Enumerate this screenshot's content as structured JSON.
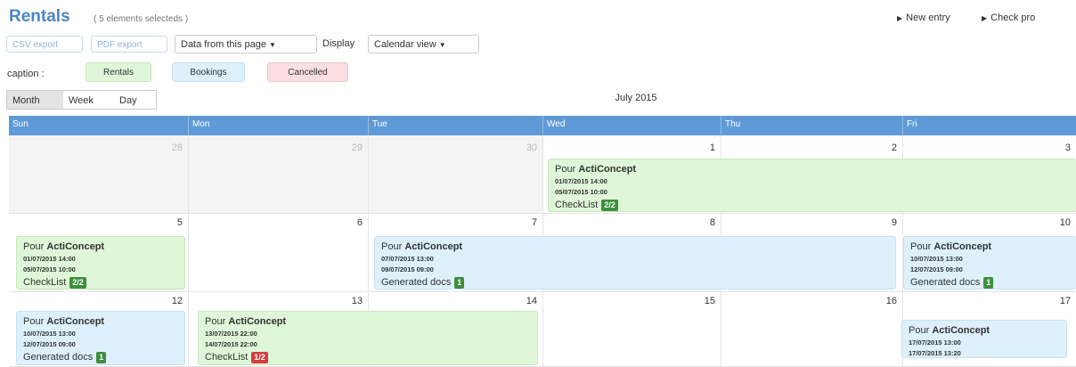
{
  "header": {
    "title": "Rentals",
    "subtitle": "( 5 elements selecteds )",
    "new_entry": "New entry",
    "check": "Check pro"
  },
  "toolbar": {
    "csv_export": "CSV export",
    "pdf_export": "PDF export",
    "data_from": "Data from this page",
    "display_label": "Display",
    "view_select": "Calendar view"
  },
  "legend": {
    "label": "caption :",
    "rentals": "Rentals",
    "bookings": "Bookings",
    "cancelled": "Cancelled"
  },
  "views": {
    "month": "Month",
    "week": "Week",
    "day": "Day"
  },
  "month_label": "July 2015",
  "days": [
    "Sun",
    "Mon",
    "Tue",
    "Wed",
    "Thu",
    "Fri"
  ],
  "weeks": [
    [
      "28",
      "29",
      "30",
      "1",
      "2",
      "3"
    ],
    [
      "5",
      "6",
      "7",
      "8",
      "9",
      "10"
    ],
    [
      "12",
      "13",
      "14",
      "15",
      "16",
      "17"
    ]
  ],
  "events": [
    {
      "prefix": "Pour",
      "name": "ActiConcept",
      "start": "01/07/2015 14:00",
      "end": "05/07/2015 10:00",
      "doc": "CheckList",
      "badge": "2/2"
    },
    {
      "prefix": "Pour",
      "name": "ActiConcept",
      "start": "01/07/2015 14:00",
      "end": "05/07/2015 10:00",
      "doc": "CheckList",
      "badge": "2/2"
    },
    {
      "prefix": "Pour",
      "name": "ActiConcept",
      "start": "07/07/2015 13:00",
      "end": "09/07/2015 09:00",
      "doc": "Generated docs",
      "badge": "1"
    },
    {
      "prefix": "Pour",
      "name": "ActiConcept",
      "start": "10/07/2015 13:00",
      "end": "12/07/2015 09:00",
      "doc": "Generated docs",
      "badge": "1"
    },
    {
      "prefix": "Pour",
      "name": "ActiConcept",
      "start": "10/07/2015 13:00",
      "end": "12/07/2015 09:00",
      "doc": "Generated docs",
      "badge": "1"
    },
    {
      "prefix": "Pour",
      "name": "ActiConcept",
      "start": "13/07/2015 22:00",
      "end": "14/07/2015 22:00",
      "doc": "CheckList",
      "badge": "1/2"
    },
    {
      "prefix": "Pour",
      "name": "ActiConcept",
      "start": "17/07/2015 13:00",
      "end": "17/07/2015 13:20"
    }
  ],
  "colors": {
    "accent": "#4a86c5",
    "header_bar": "#5f9ad6",
    "rental_bg": "#dff7d8",
    "booking_bg": "#def0fb",
    "cancelled_bg": "#fbdfe0",
    "badge_green": "#3e8f3e",
    "badge_red": "#d43f3f"
  }
}
